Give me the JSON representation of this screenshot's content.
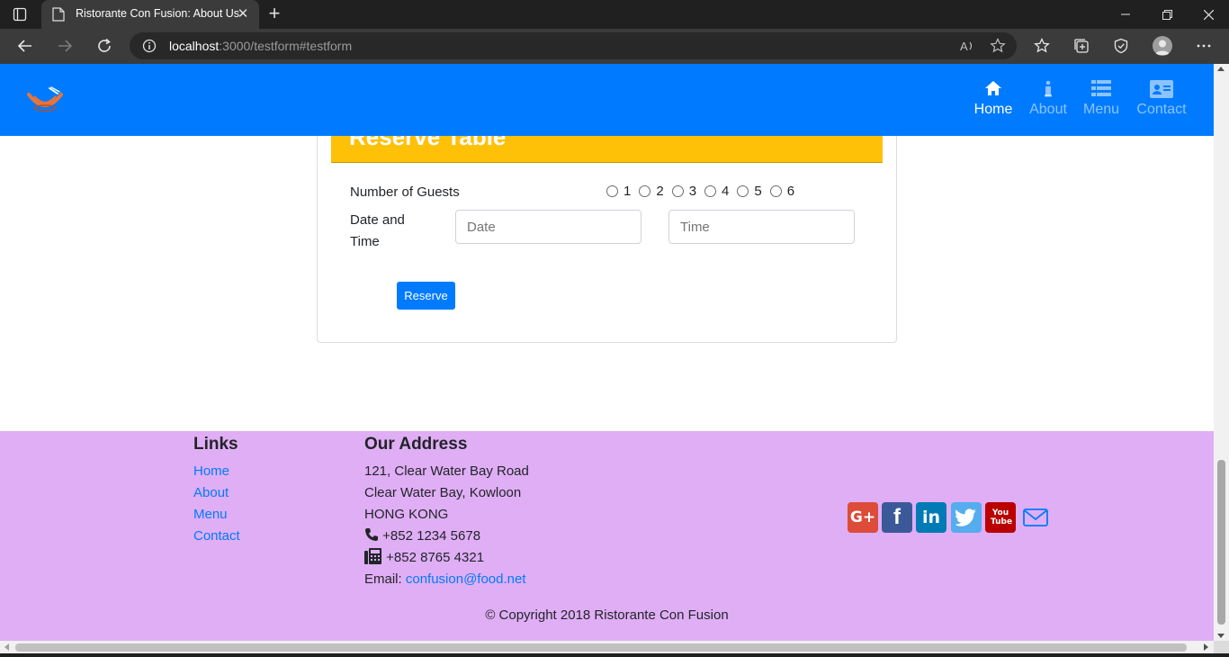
{
  "browser": {
    "tab_title": "Ristorante Con Fusion: About Us",
    "tab_close": "✕",
    "new_tab": "+",
    "url_host": "localhost",
    "url_rest": ":3000/testform#testform"
  },
  "navbar": {
    "items": [
      {
        "label": "Home",
        "icon": "home-icon",
        "active": true
      },
      {
        "label": "About",
        "icon": "info-icon",
        "active": false
      },
      {
        "label": "Menu",
        "icon": "list-icon",
        "active": false
      },
      {
        "label": "Contact",
        "icon": "address-card-icon",
        "active": false
      }
    ]
  },
  "reservation": {
    "title": "Reserve Table",
    "guests_label": "Number of Guests",
    "guest_options": [
      "1",
      "2",
      "3",
      "4",
      "5",
      "6"
    ],
    "datetime_label_line1": "Date and",
    "datetime_label_line2": "Time",
    "date_placeholder": "Date",
    "time_placeholder": "Time",
    "submit_label": "Reserve"
  },
  "footer": {
    "links_heading": "Links",
    "links": [
      "Home",
      "About",
      "Menu",
      "Contact"
    ],
    "address_heading": "Our Address",
    "address_lines": [
      "121, Clear Water Bay Road",
      "Clear Water Bay, Kowloon",
      "HONG KONG"
    ],
    "phone": "+852 1234 5678",
    "fax": "+852 8765 4321",
    "email_label": "Email:",
    "email": "confusion@food.net",
    "social": [
      {
        "name": "google-plus-icon",
        "glyph": "G+",
        "color": "#dd4b39"
      },
      {
        "name": "facebook-icon",
        "glyph": "f",
        "color": "#3b5998"
      },
      {
        "name": "linkedin-icon",
        "glyph": "in",
        "color": "#007bb6"
      },
      {
        "name": "twitter-icon",
        "glyph": "t",
        "color": "#55acee"
      },
      {
        "name": "youtube-icon",
        "glyph": "You Tube",
        "color": "#bb0000"
      }
    ],
    "copyright": "© Copyright 2018 Ristorante Con Fusion"
  },
  "colors": {
    "navbar": "#007bff",
    "card_header": "#ffc107",
    "footer": "#e0aef5",
    "link": "#007bff"
  }
}
